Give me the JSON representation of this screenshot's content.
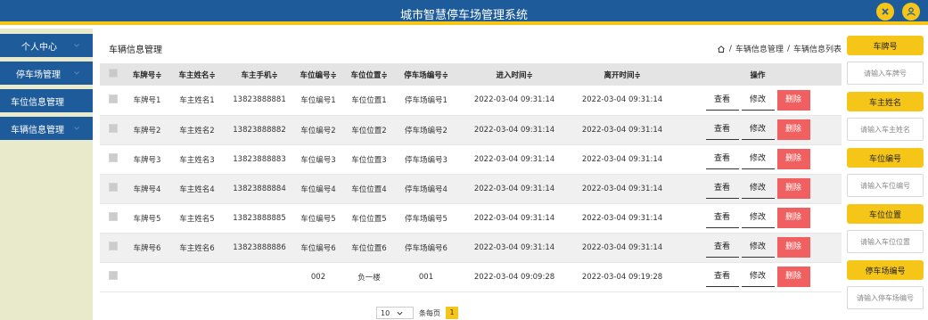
{
  "header": {
    "title": "城市智慧停车场管理系统"
  },
  "sidebar": {
    "items": [
      {
        "label": "个人中心"
      },
      {
        "label": "停车场管理"
      },
      {
        "label": "车位信息管理"
      },
      {
        "label": "车辆信息管理"
      }
    ]
  },
  "main": {
    "title": "车辆信息管理",
    "breadcrumb": {
      "separator": "/",
      "level1": "车辆信息管理",
      "level2": "车辆信息列表"
    }
  },
  "table": {
    "headers": [
      "车牌号≑",
      "车主姓名≑",
      "车主手机≑",
      "车位编号≑",
      "车位位置≑",
      "停车场编号≑",
      "进入时间≑",
      "离开时间≑",
      "操作"
    ],
    "rows": [
      [
        "车牌号1",
        "车主姓名1",
        "13823888881",
        "车位编号1",
        "车位位置1",
        "停车场编号1",
        "2022-03-04 09:31:14",
        "2022-03-04 09:31:14"
      ],
      [
        "车牌号2",
        "车主姓名2",
        "13823888882",
        "车位编号2",
        "车位位置2",
        "停车场编号2",
        "2022-03-04 09:31:14",
        "2022-03-04 09:31:14"
      ],
      [
        "车牌号3",
        "车主姓名3",
        "13823888883",
        "车位编号3",
        "车位位置3",
        "停车场编号3",
        "2022-03-04 09:31:14",
        "2022-03-04 09:31:14"
      ],
      [
        "车牌号4",
        "车主姓名4",
        "13823888884",
        "车位编号4",
        "车位位置4",
        "停车场编号4",
        "2022-03-04 09:31:14",
        "2022-03-04 09:31:14"
      ],
      [
        "车牌号5",
        "车主姓名5",
        "13823888885",
        "车位编号5",
        "车位位置5",
        "停车场编号5",
        "2022-03-04 09:31:14",
        "2022-03-04 09:31:14"
      ],
      [
        "车牌号6",
        "车主姓名6",
        "13823888886",
        "车位编号6",
        "车位位置6",
        "停车场编号6",
        "2022-03-04 09:31:14",
        "2022-03-04 09:31:14"
      ],
      [
        "",
        "",
        "",
        "002",
        "负一楼",
        "001",
        "2022-03-04 09:09:28",
        "2022-03-04 09:19:28"
      ]
    ],
    "actions": {
      "view": "查看",
      "edit": "修改",
      "delete": "删除"
    }
  },
  "pagination": {
    "page_size": "10",
    "per_page_label": "条每页",
    "current_page": "1"
  },
  "search_panel": {
    "fields": [
      {
        "label": "车牌号",
        "placeholder": "请输入车牌号"
      },
      {
        "label": "车主姓名",
        "placeholder": "请输入车主姓名"
      },
      {
        "label": "车位编号",
        "placeholder": "请输入车位编号"
      },
      {
        "label": "车位位置",
        "placeholder": "请输入车位位置"
      },
      {
        "label": "停车场编号",
        "placeholder": "请输入停车场编号"
      }
    ]
  },
  "colors": {
    "primary": "#1e5b9a",
    "accent": "#f5c518",
    "danger": "#f06060",
    "sidebar_bg": "#e8eacb"
  },
  "icons": {
    "header_left": "close-icon",
    "header_right": "user-icon",
    "breadcrumb": "home-icon"
  }
}
